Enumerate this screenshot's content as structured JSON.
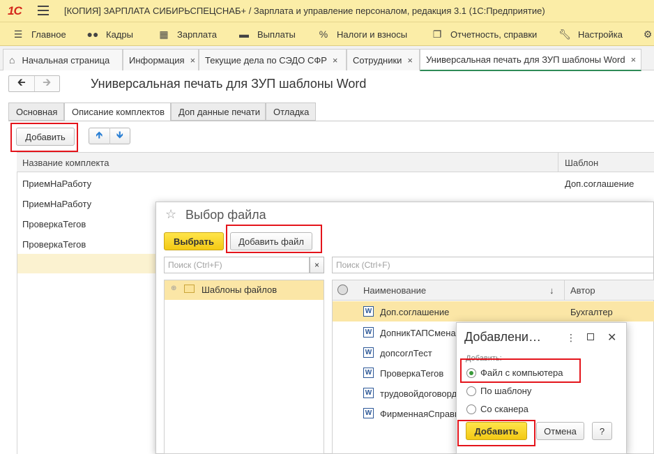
{
  "app": {
    "logo": "1С",
    "title": "[КОПИЯ] ЗАРПЛАТА СИБИРЬСПЕЦСНАБ+ / Зарплата и управление персоналом, редакция 3.1  (1С:Предприятие)"
  },
  "menu": {
    "items": [
      {
        "label": "Главное",
        "icon": "hamburger-icon"
      },
      {
        "label": "Кадры",
        "icon": "people-icon"
      },
      {
        "label": "Зарплата",
        "icon": "calculator-icon"
      },
      {
        "label": "Выплаты",
        "icon": "wallet-icon"
      },
      {
        "label": "Налоги и взносы",
        "icon": "percent-icon"
      },
      {
        "label": "Отчетность, справки",
        "icon": "report-icon"
      },
      {
        "label": "Настройка",
        "icon": "wrench-icon"
      },
      {
        "label": "",
        "icon": "gear-icon"
      }
    ]
  },
  "tabs": [
    {
      "label": "Начальная страница",
      "icon": "home-icon"
    },
    {
      "label": "Информация",
      "close": "×"
    },
    {
      "label": "Текущие дела по СЭДО СФР",
      "close": "×"
    },
    {
      "label": "Сотрудники",
      "close": "×"
    },
    {
      "label": "Универсальная печать для ЗУП шаблоны Word",
      "close": "×"
    }
  ],
  "form": {
    "title": "Универсальная печать для ЗУП шаблоны Word",
    "tabs": [
      "Основная",
      "Описание комплектов",
      "Доп данные печати",
      "Отладка"
    ],
    "add_label": "Добавить",
    "grid": {
      "columns": [
        "Название комплекта",
        "Шаблон"
      ],
      "rows": [
        [
          "ПриемНаРаботу",
          "Доп.соглашение"
        ],
        [
          "ПриемНаРаботу",
          ""
        ],
        [
          "ПроверкаТегов",
          ""
        ],
        [
          "ПроверкаТегов",
          ""
        ]
      ]
    }
  },
  "file_dialog": {
    "title": "Выбор файла",
    "select_label": "Выбрать",
    "add_file_label": "Добавить файл",
    "search_placeholder": "Поиск (Ctrl+F)",
    "search_clear": "×",
    "tree_item": "Шаблоны файлов",
    "list": {
      "columns": [
        "Наименование",
        "Автор"
      ],
      "sort_arrow": "↓",
      "rows": [
        {
          "name": "Доп.соглашение",
          "author": "Бухгалтер"
        },
        {
          "name": "ДопникТАПСмена",
          "author": ""
        },
        {
          "name": "допсоглТест",
          "author": ""
        },
        {
          "name": "ПроверкаТегов",
          "author": ""
        },
        {
          "name": "трудовойдоговорд",
          "author": ""
        },
        {
          "name": "ФирменнаяСправк",
          "author": ""
        }
      ]
    }
  },
  "add_dialog": {
    "title": "Добавлени…",
    "group_label": "Добавить:",
    "options": [
      "Файл с компьютера",
      "По шаблону",
      "Со сканера"
    ],
    "selected_index": 0,
    "add_label": "Добавить",
    "cancel_label": "Отмена",
    "help_label": "?"
  },
  "colors": {
    "title_bar": "#fbeda7",
    "accent_yellow": "#f3c914",
    "highlight_red": "#e4141b",
    "selection": "#fbe6a6",
    "active_tab_underline": "#2e8b57"
  }
}
